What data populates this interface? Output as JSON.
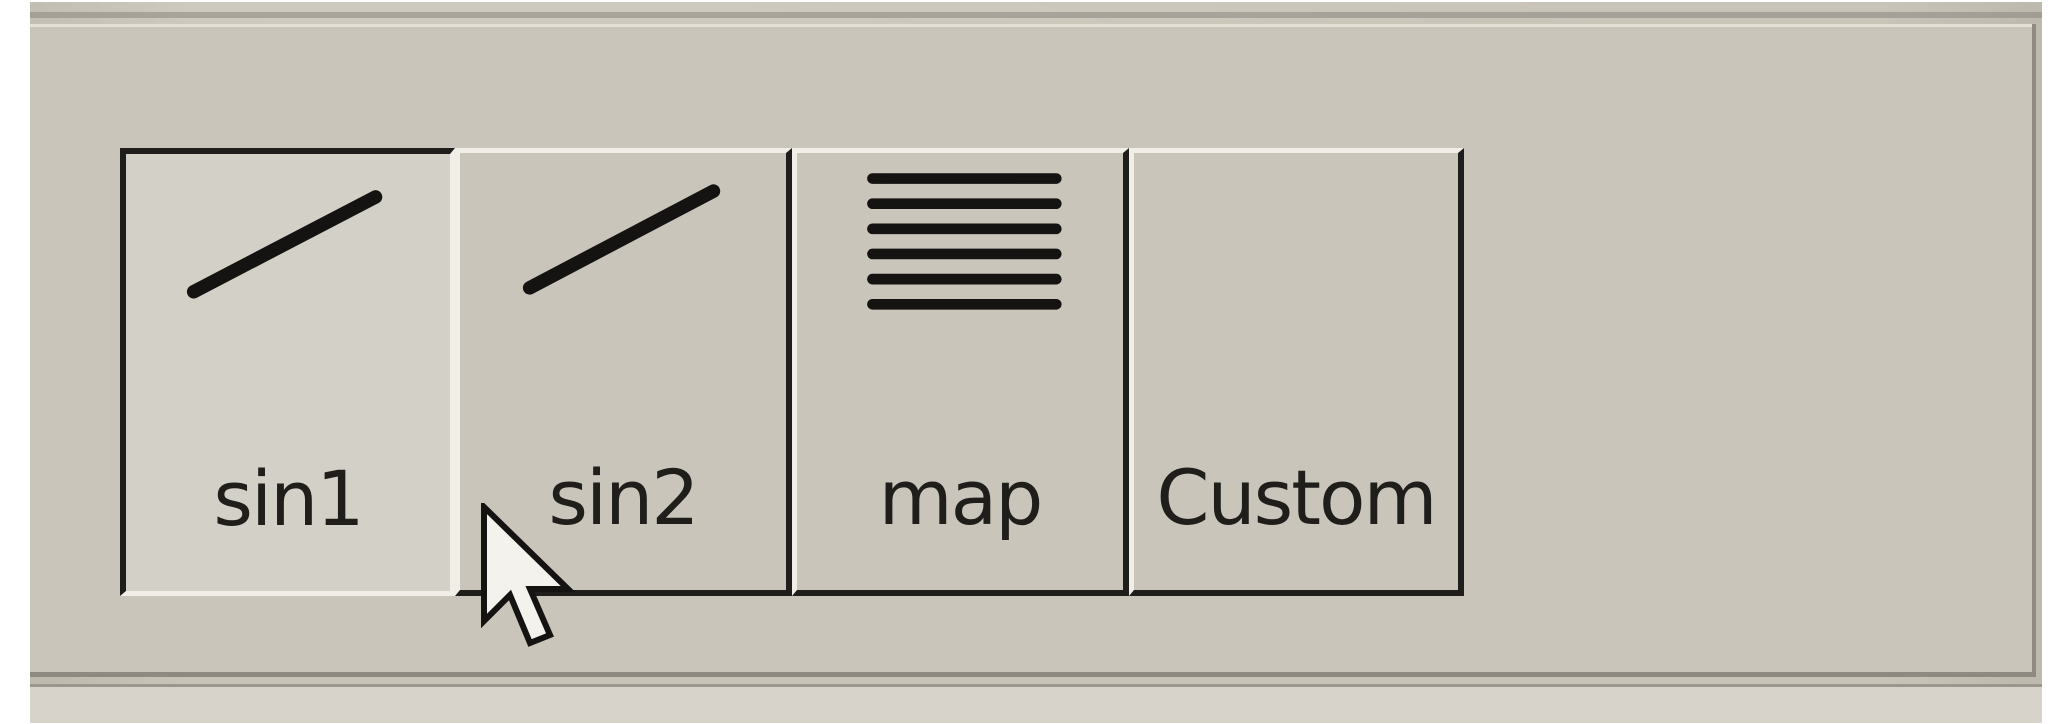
{
  "toolbar": {
    "buttons": [
      {
        "label": "sin1",
        "icon": "diagonal-line-icon",
        "pressed": true
      },
      {
        "label": "sin2",
        "icon": "diagonal-line-icon",
        "pressed": false
      },
      {
        "label": "map",
        "icon": "horizontal-lines-icon",
        "pressed": false
      },
      {
        "label": "Custom",
        "icon": "",
        "pressed": false
      }
    ]
  },
  "cursor": {
    "icon": "arrow-cursor-icon"
  },
  "colors": {
    "face": "#c9c5bb",
    "highlight": "#f1eee8",
    "shadow": "#1f1e1c",
    "ink": "#1f1e1b"
  }
}
